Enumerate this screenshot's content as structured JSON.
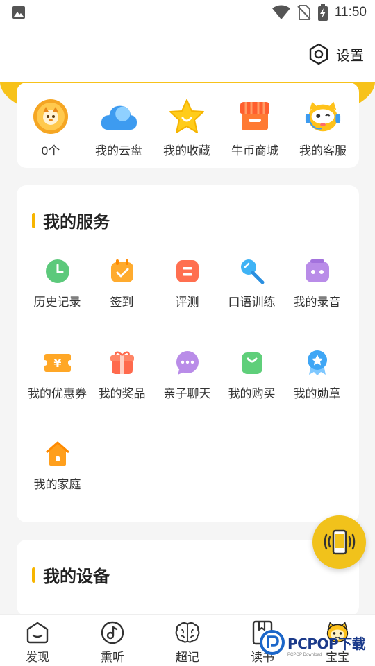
{
  "status_bar": {
    "time": "11:50"
  },
  "header": {
    "settings_label": "设置"
  },
  "quick_actions": [
    {
      "label": "0个",
      "icon": "coin-icon"
    },
    {
      "label": "我的云盘",
      "icon": "cloud-icon"
    },
    {
      "label": "我的收藏",
      "icon": "star-icon"
    },
    {
      "label": "牛币商城",
      "icon": "shop-icon"
    },
    {
      "label": "我的客服",
      "icon": "customer-service-icon"
    }
  ],
  "services": {
    "title": "我的服务",
    "items": [
      {
        "label": "历史记录",
        "icon": "clock-icon"
      },
      {
        "label": "签到",
        "icon": "checkin-icon"
      },
      {
        "label": "评测",
        "icon": "evaluation-icon"
      },
      {
        "label": "口语训练",
        "icon": "microphone-icon"
      },
      {
        "label": "我的录音",
        "icon": "recording-icon"
      },
      {
        "label": "我的优惠券",
        "icon": "coupon-icon"
      },
      {
        "label": "我的奖品",
        "icon": "gift-icon"
      },
      {
        "label": "亲子聊天",
        "icon": "chat-icon"
      },
      {
        "label": "我的购买",
        "icon": "shopping-bag-icon"
      },
      {
        "label": "我的勋章",
        "icon": "medal-icon"
      },
      {
        "label": "我的家庭",
        "icon": "home-icon"
      }
    ]
  },
  "devices": {
    "title": "我的设备"
  },
  "tabbar": [
    {
      "label": "发现",
      "icon": "discover-icon"
    },
    {
      "label": "熏听",
      "icon": "music-note-icon"
    },
    {
      "label": "超记",
      "icon": "brain-icon"
    },
    {
      "label": "读书",
      "icon": "book-icon"
    },
    {
      "label": "宝宝",
      "icon": "baby-mascot-icon"
    }
  ],
  "watermark": {
    "brand": "PCPOP下载",
    "sub": "PCPOP Download"
  },
  "colors": {
    "accent": "#f7c21a",
    "title_bar": "#f7b500",
    "background": "#f5f5f5"
  }
}
